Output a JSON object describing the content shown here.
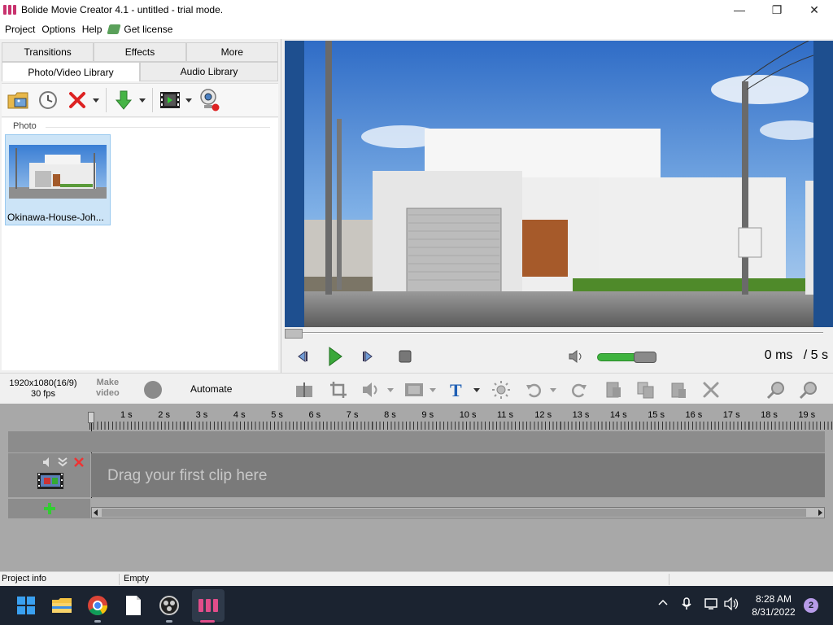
{
  "window": {
    "title": "Bolide Movie Creator 4.1 - untitled  - trial mode.",
    "minimize": "—",
    "maximize": "❐",
    "close": "✕"
  },
  "menu": {
    "items": [
      "Project",
      "Options",
      "Help"
    ],
    "license": "Get license"
  },
  "library": {
    "tabs_top": [
      "Transitions",
      "Effects",
      "More"
    ],
    "tabs_bottom": [
      "Photo/Video Library",
      "Audio Library"
    ],
    "active_tab": "Photo/Video Library",
    "section": "Photo",
    "items": [
      {
        "label": "Okinawa-House-Joh..."
      }
    ],
    "toolbar_icons": [
      "open-folder-icon",
      "history-icon",
      "delete-icon",
      "import-icon",
      "film-icon",
      "webcam-icon"
    ]
  },
  "player": {
    "position_ms": 0,
    "time_current": "0 ms",
    "time_total": "/ 5 s",
    "volume": 0.72
  },
  "edit_toolbar": {
    "resolution": "1920x1080(16/9)",
    "fps": "30 fps",
    "make_video_1": "Make",
    "make_video_2": "video",
    "automate": "Automate"
  },
  "timeline": {
    "ruler": [
      "1 s",
      "2 s",
      "3 s",
      "4 s",
      "5 s",
      "6 s",
      "7 s",
      "8 s",
      "9 s",
      "10 s",
      "11 s",
      "12 s",
      "13 s",
      "14 s",
      "15 s",
      "16 s",
      "17 s",
      "18 s",
      "19 s"
    ],
    "drag_hint": "Drag your first clip here"
  },
  "status": {
    "left": "Project info",
    "right": "Empty"
  },
  "taskbar": {
    "time": "8:28 AM",
    "date": "8/31/2022",
    "notifications": "2"
  },
  "colors": {
    "preview_border": "#1e4f8f",
    "volume_green": "#3fb33f",
    "play_green": "#3aa83a",
    "taskbar": "#1b2330"
  }
}
